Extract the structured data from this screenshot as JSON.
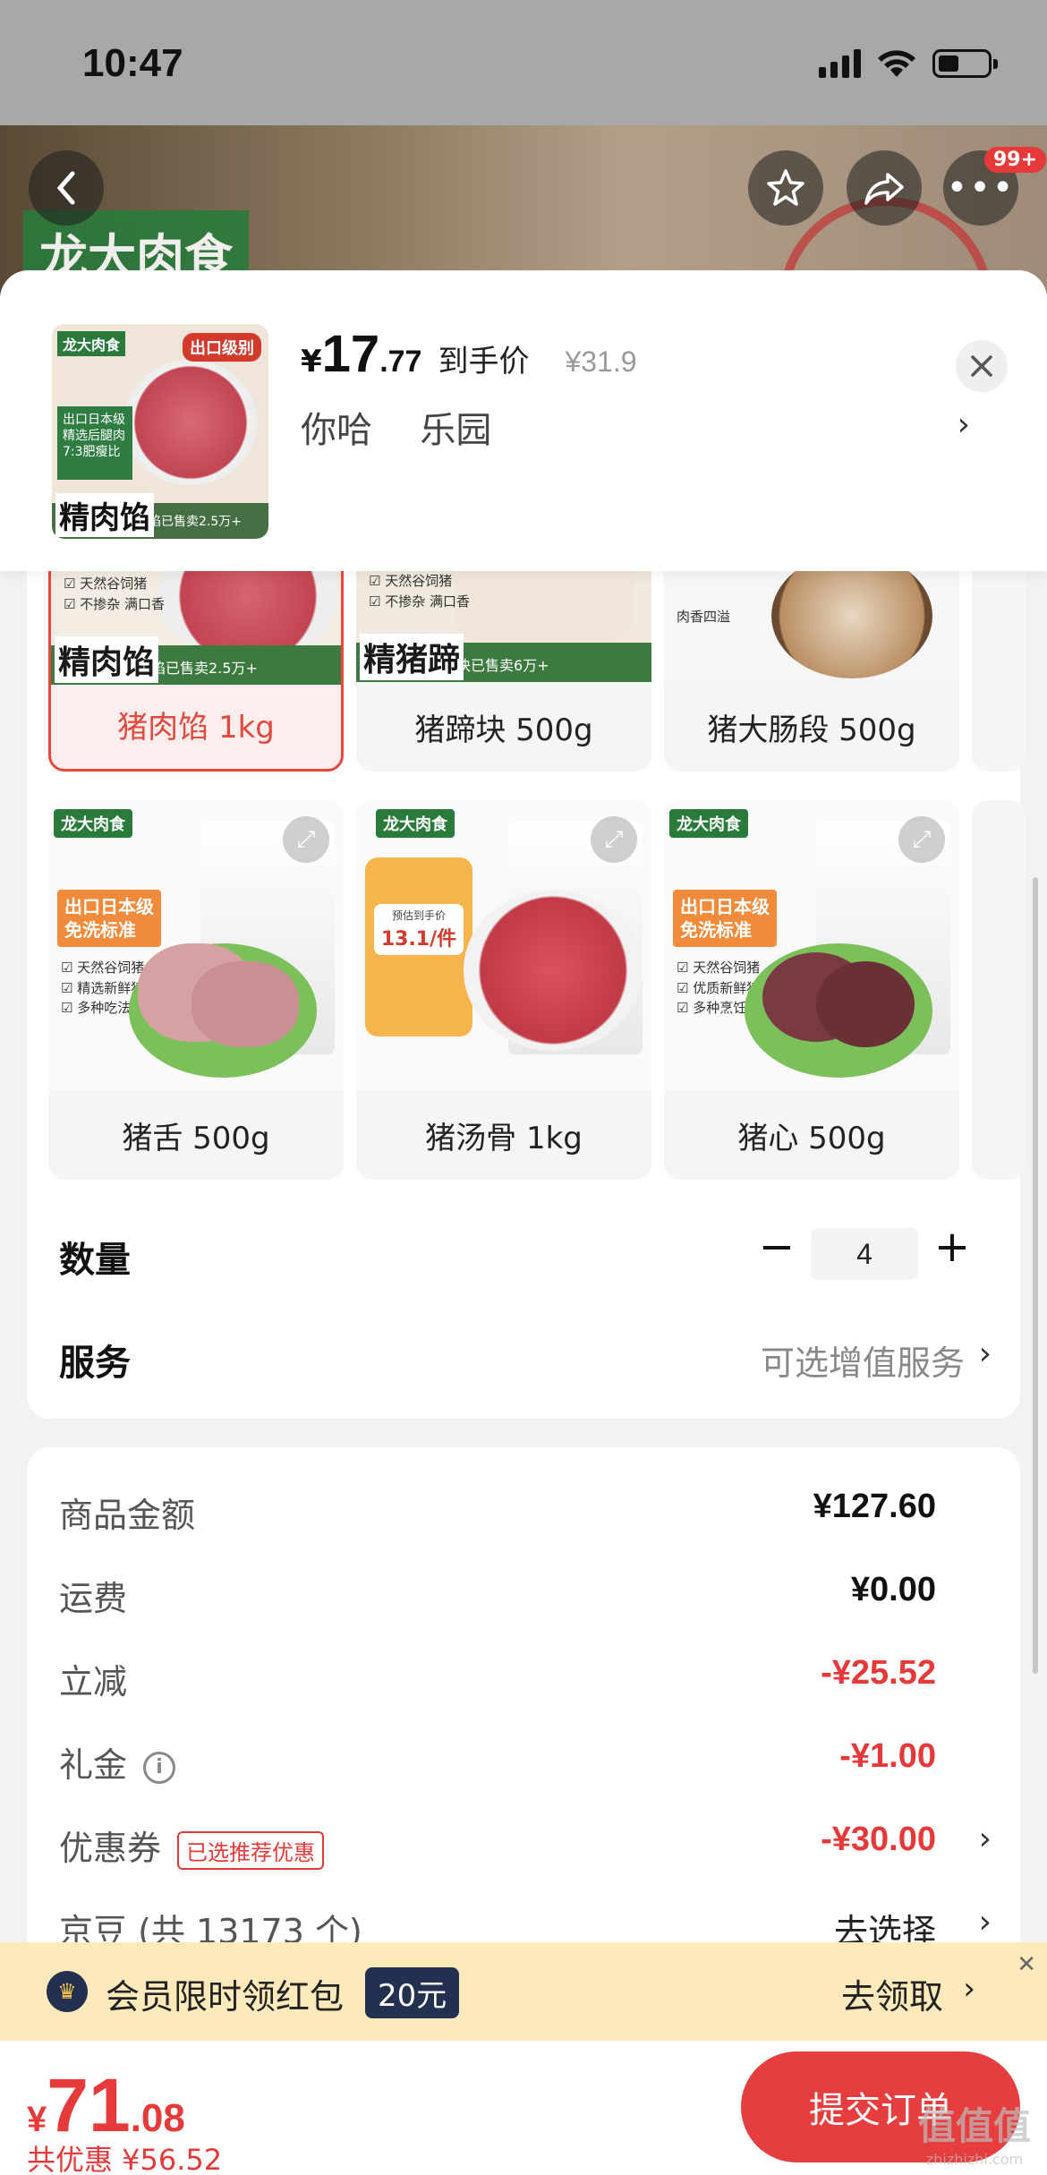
{
  "status_bar": {
    "time": "10:47"
  },
  "nav": {
    "badge": "99+"
  },
  "hero": {
    "brand_text": "龙大肉食"
  },
  "summary": {
    "yen": "¥",
    "price_int": "17",
    "price_dec": ".77",
    "price_label": "到手价",
    "original_price": "¥31.9",
    "spec": "你哈  乐园",
    "thumb": {
      "logo": "龙大肉食",
      "tag": "出口级别",
      "side": "出口日本级 精选后腿肉 7:3肥瘦比",
      "footer": "猪肉馅已售卖2.5万+",
      "big": "精肉馅"
    }
  },
  "products": [
    {
      "label": "猪肉馅 1kg",
      "selected": true,
      "badge": "精肉馅",
      "footer": "猪肉馅已售卖2.5万+"
    },
    {
      "label": "猪蹄块 500g",
      "selected": false,
      "badge": "精猪蹄",
      "footer": "猪蹄块已售卖6万+"
    },
    {
      "label": "猪大肠段 500g",
      "selected": false,
      "note": "肉香四溢"
    },
    {
      "label": "猪舌 500g",
      "selected": false,
      "promo": "出口日本级\n免洗标准",
      "bullets": [
        "天然谷饲猪",
        "精选新鲜猪舌",
        "多种吃法"
      ]
    },
    {
      "label": "猪汤骨 1kg",
      "selected": false,
      "promo_price": "13.1/件",
      "promo_top": "预估到手价"
    },
    {
      "label": "猪心 500g",
      "selected": false,
      "promo": "出口日本级\n免洗标准",
      "bullets": [
        "天然谷饲猪",
        "优质新鲜猪心",
        "多种烹饪方式"
      ]
    }
  ],
  "tile_logo": "龙大肉食",
  "quantity": {
    "label": "数量",
    "minus": "−",
    "value": "4",
    "plus": "+"
  },
  "service": {
    "label": "服务",
    "value": "可选增值服务"
  },
  "pricing": {
    "rows": [
      {
        "label": "商品金额",
        "value": "¥127.60",
        "red": false
      },
      {
        "label": "运费",
        "value": "¥0.00",
        "red": false
      },
      {
        "label": "立减",
        "value": "-¥25.52",
        "red": true
      },
      {
        "label": "礼金",
        "value": "-¥1.00",
        "red": true
      },
      {
        "label": "优惠券",
        "value": "-¥30.00",
        "red": true,
        "tag": "已选推荐优惠"
      },
      {
        "label": "京豆 (共 13173 个)",
        "value": "去选择",
        "red": false
      }
    ]
  },
  "banner": {
    "text": "会员限时领红包",
    "chip": "20元",
    "action": "去领取",
    "icon": "crown-icon"
  },
  "bottom": {
    "yen": "¥",
    "total_int": "71",
    "total_dec": ".08",
    "saved": "共优惠 ¥56.52",
    "submit": "提交订单"
  },
  "watermark": {
    "main": "值值值",
    "sub": "zhizhizhi.com"
  },
  "colors": {
    "accent": "#e5393a",
    "member": "#23304f",
    "banner_bg": "#fde9b9"
  }
}
